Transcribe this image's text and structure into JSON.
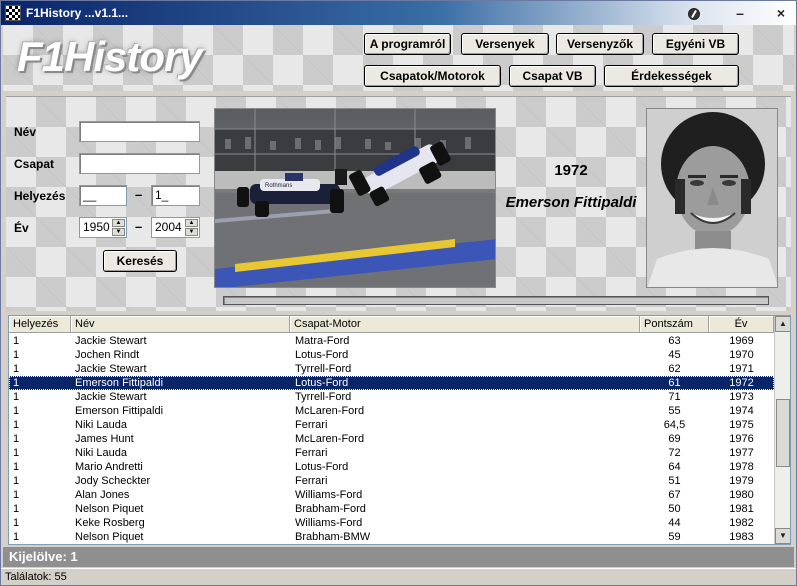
{
  "window": {
    "title": "F1History ...v1.1..."
  },
  "header": {
    "logo": "F1History",
    "buttons": [
      "A programról",
      "Versenyek",
      "Versenyzők",
      "Egyéni VB",
      "Csapatok/Motorok",
      "Csapat VB",
      "Érdekességek"
    ]
  },
  "filter": {
    "name_label": "Név",
    "name_value": "",
    "team_label": "Csapat",
    "team_value": "",
    "position_label": "Helyezés",
    "position_from": "__",
    "position_to": "1_",
    "year_label": "Év",
    "year_from": "1950",
    "year_to": "2004",
    "separator": "–",
    "search_button": "Keresés"
  },
  "detail": {
    "year": "1972",
    "driver": "Emerson Fittipaldi"
  },
  "list": {
    "columns": [
      "Helyezés",
      "Név",
      "Csapat-Motor",
      "Pontszám",
      "Év"
    ],
    "selected_index": 3,
    "rows": [
      [
        "1",
        "Jackie Stewart",
        "Matra-Ford",
        "63",
        "1969"
      ],
      [
        "1",
        "Jochen Rindt",
        "Lotus-Ford",
        "45",
        "1970"
      ],
      [
        "1",
        "Jackie Stewart",
        "Tyrrell-Ford",
        "62",
        "1971"
      ],
      [
        "1",
        "Emerson Fittipaldi",
        "Lotus-Ford",
        "61",
        "1972"
      ],
      [
        "1",
        "Jackie Stewart",
        "Tyrrell-Ford",
        "71",
        "1973"
      ],
      [
        "1",
        "Emerson Fittipaldi",
        "McLaren-Ford",
        "55",
        "1974"
      ],
      [
        "1",
        "Niki Lauda",
        "Ferrari",
        "64,5",
        "1975"
      ],
      [
        "1",
        "James Hunt",
        "McLaren-Ford",
        "69",
        "1976"
      ],
      [
        "1",
        "Niki Lauda",
        "Ferrari",
        "72",
        "1977"
      ],
      [
        "1",
        "Mario Andretti",
        "Lotus-Ford",
        "64",
        "1978"
      ],
      [
        "1",
        "Jody Scheckter",
        "Ferrari",
        "51",
        "1979"
      ],
      [
        "1",
        "Alan Jones",
        "Williams-Ford",
        "67",
        "1980"
      ],
      [
        "1",
        "Nelson Piquet",
        "Brabham-Ford",
        "50",
        "1981"
      ],
      [
        "1",
        "Keke Rosberg",
        "Williams-Ford",
        "44",
        "1982"
      ],
      [
        "1",
        "Nelson Piquet",
        "Brabham-BMW",
        "59",
        "1983"
      ]
    ]
  },
  "status": {
    "selected": "Kijelölve: 1",
    "results": "Találatok: 55"
  }
}
